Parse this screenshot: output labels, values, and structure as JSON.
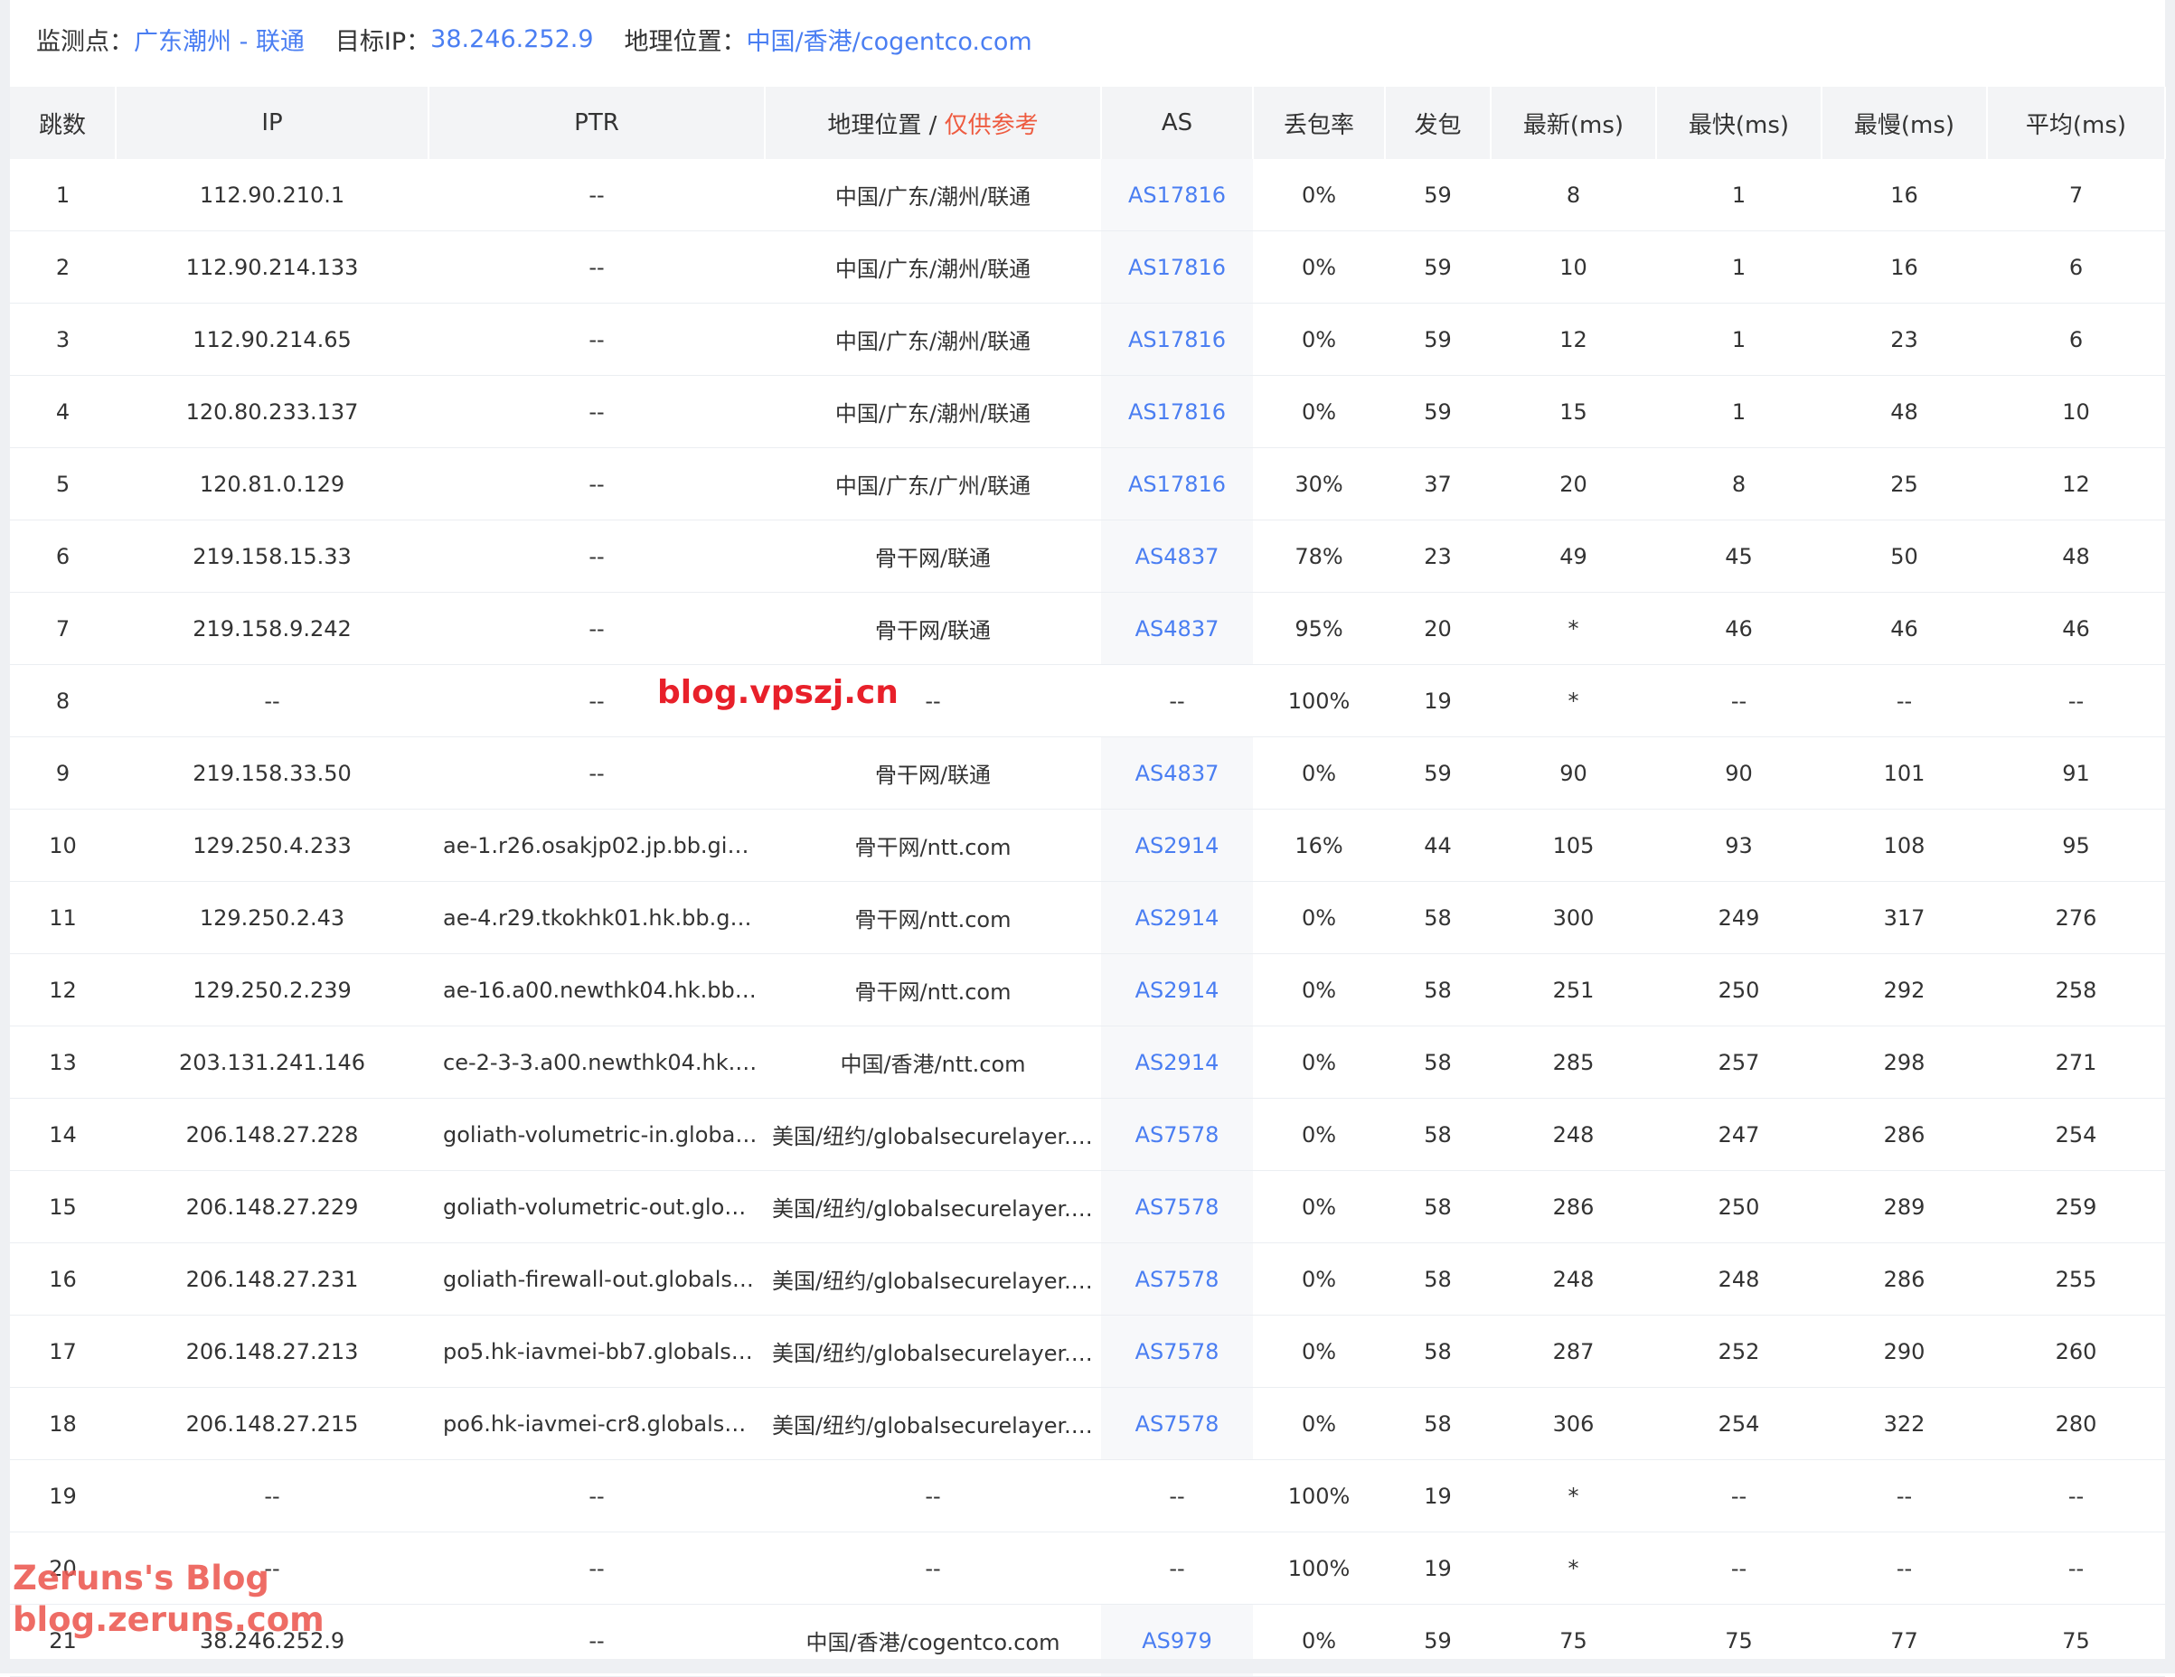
{
  "header": {
    "monitor_label": "监测点：",
    "monitor_value": "广东潮州 - 联通",
    "target_label": "目标IP：",
    "target_value": "38.246.252.9",
    "geo_label": "地理位置：",
    "geo_value": "中国/香港/cogentco.com"
  },
  "table": {
    "columns": {
      "hop": "跳数",
      "ip": "IP",
      "ptr": "PTR",
      "geo": "地理位置 / ",
      "geo_note": "仅供参考",
      "as": "AS",
      "loss": "丢包率",
      "sent": "发包",
      "last": "最新(ms)",
      "best": "最快(ms)",
      "worst": "最慢(ms)",
      "avg": "平均(ms)"
    },
    "rows": [
      {
        "hop": "1",
        "ip": "112.90.210.1",
        "ptr": "--",
        "geo": "中国/广东/潮州/联通",
        "as": "AS17816",
        "loss": "0%",
        "sent": "59",
        "last": "8",
        "best": "1",
        "worst": "16",
        "avg": "7"
      },
      {
        "hop": "2",
        "ip": "112.90.214.133",
        "ptr": "--",
        "geo": "中国/广东/潮州/联通",
        "as": "AS17816",
        "loss": "0%",
        "sent": "59",
        "last": "10",
        "best": "1",
        "worst": "16",
        "avg": "6"
      },
      {
        "hop": "3",
        "ip": "112.90.214.65",
        "ptr": "--",
        "geo": "中国/广东/潮州/联通",
        "as": "AS17816",
        "loss": "0%",
        "sent": "59",
        "last": "12",
        "best": "1",
        "worst": "23",
        "avg": "6"
      },
      {
        "hop": "4",
        "ip": "120.80.233.137",
        "ptr": "--",
        "geo": "中国/广东/潮州/联通",
        "as": "AS17816",
        "loss": "0%",
        "sent": "59",
        "last": "15",
        "best": "1",
        "worst": "48",
        "avg": "10"
      },
      {
        "hop": "5",
        "ip": "120.81.0.129",
        "ptr": "--",
        "geo": "中国/广东/广州/联通",
        "as": "AS17816",
        "loss": "30%",
        "sent": "37",
        "last": "20",
        "best": "8",
        "worst": "25",
        "avg": "12"
      },
      {
        "hop": "6",
        "ip": "219.158.15.33",
        "ptr": "--",
        "geo": "骨干网/联通",
        "as": "AS4837",
        "loss": "78%",
        "sent": "23",
        "last": "49",
        "best": "45",
        "worst": "50",
        "avg": "48"
      },
      {
        "hop": "7",
        "ip": "219.158.9.242",
        "ptr": "--",
        "geo": "骨干网/联通",
        "as": "AS4837",
        "loss": "95%",
        "sent": "20",
        "last": "*",
        "best": "46",
        "worst": "46",
        "avg": "46"
      },
      {
        "hop": "8",
        "ip": "--",
        "ptr": "--",
        "geo": "--",
        "as": "--",
        "loss": "100%",
        "sent": "19",
        "last": "*",
        "best": "--",
        "worst": "--",
        "avg": "--"
      },
      {
        "hop": "9",
        "ip": "219.158.33.50",
        "ptr": "--",
        "geo": "骨干网/联通",
        "as": "AS4837",
        "loss": "0%",
        "sent": "59",
        "last": "90",
        "best": "90",
        "worst": "101",
        "avg": "91"
      },
      {
        "hop": "10",
        "ip": "129.250.4.233",
        "ptr": "ae-1.r26.osakjp02.jp.bb.gin.n...",
        "geo": "骨干网/ntt.com",
        "as": "AS2914",
        "loss": "16%",
        "sent": "44",
        "last": "105",
        "best": "93",
        "worst": "108",
        "avg": "95"
      },
      {
        "hop": "11",
        "ip": "129.250.2.43",
        "ptr": "ae-4.r29.tkokhk01.hk.bb.gin....",
        "geo": "骨干网/ntt.com",
        "as": "AS2914",
        "loss": "0%",
        "sent": "58",
        "last": "300",
        "best": "249",
        "worst": "317",
        "avg": "276"
      },
      {
        "hop": "12",
        "ip": "129.250.2.239",
        "ptr": "ae-16.a00.newthk04.hk.bb.gi...",
        "geo": "骨干网/ntt.com",
        "as": "AS2914",
        "loss": "0%",
        "sent": "58",
        "last": "251",
        "best": "250",
        "worst": "292",
        "avg": "258"
      },
      {
        "hop": "13",
        "ip": "203.131.241.146",
        "ptr": "ce-2-3-3.a00.newthk04.hk.ce...",
        "geo": "中国/香港/ntt.com",
        "as": "AS2914",
        "loss": "0%",
        "sent": "58",
        "last": "285",
        "best": "257",
        "worst": "298",
        "avg": "271"
      },
      {
        "hop": "14",
        "ip": "206.148.27.228",
        "ptr": "goliath-volumetric-in.globals...",
        "geo": "美国/纽约/globalsecurelayer.c...",
        "as": "AS7578",
        "loss": "0%",
        "sent": "58",
        "last": "248",
        "best": "247",
        "worst": "286",
        "avg": "254"
      },
      {
        "hop": "15",
        "ip": "206.148.27.229",
        "ptr": "goliath-volumetric-out.globa...",
        "geo": "美国/纽约/globalsecurelayer.c...",
        "as": "AS7578",
        "loss": "0%",
        "sent": "58",
        "last": "286",
        "best": "250",
        "worst": "289",
        "avg": "259"
      },
      {
        "hop": "16",
        "ip": "206.148.27.231",
        "ptr": "goliath-firewall-out.globalse...",
        "geo": "美国/纽约/globalsecurelayer.c...",
        "as": "AS7578",
        "loss": "0%",
        "sent": "58",
        "last": "248",
        "best": "248",
        "worst": "286",
        "avg": "255"
      },
      {
        "hop": "17",
        "ip": "206.148.27.213",
        "ptr": "po5.hk-iavmei-bb7.globalsec...",
        "geo": "美国/纽约/globalsecurelayer.c...",
        "as": "AS7578",
        "loss": "0%",
        "sent": "58",
        "last": "287",
        "best": "252",
        "worst": "290",
        "avg": "260"
      },
      {
        "hop": "18",
        "ip": "206.148.27.215",
        "ptr": "po6.hk-iavmei-cr8.globalsec...",
        "geo": "美国/纽约/globalsecurelayer.c...",
        "as": "AS7578",
        "loss": "0%",
        "sent": "58",
        "last": "306",
        "best": "254",
        "worst": "322",
        "avg": "280"
      },
      {
        "hop": "19",
        "ip": "--",
        "ptr": "--",
        "geo": "--",
        "as": "--",
        "loss": "100%",
        "sent": "19",
        "last": "*",
        "best": "--",
        "worst": "--",
        "avg": "--"
      },
      {
        "hop": "20",
        "ip": "--",
        "ptr": "--",
        "geo": "--",
        "as": "--",
        "loss": "100%",
        "sent": "19",
        "last": "*",
        "best": "--",
        "worst": "--",
        "avg": "--"
      },
      {
        "hop": "21",
        "ip": "38.246.252.9",
        "ptr": "--",
        "geo": "中国/香港/cogentco.com",
        "as": "AS979",
        "loss": "0%",
        "sent": "59",
        "last": "75",
        "best": "75",
        "worst": "77",
        "avg": "75"
      }
    ]
  },
  "watermarks": {
    "center": "blog.vpszj.cn",
    "corner_line1": "Zeruns's Blog",
    "corner_line2": "blog.zeruns.com"
  },
  "colors": {
    "link_blue": "#4a7ef2",
    "note_red": "#ee5a3f",
    "watermark_red": "#e8202a",
    "header_bg": "#f3f4f6"
  }
}
